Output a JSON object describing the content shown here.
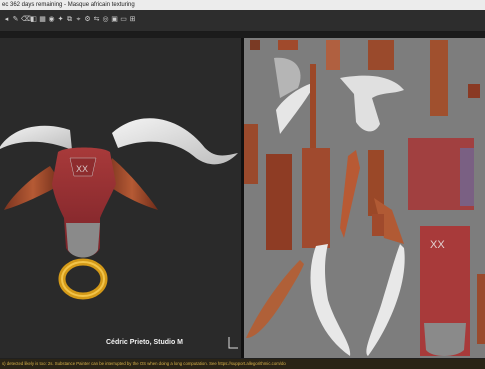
{
  "window": {
    "title": "ec 362 days remaining - Masque africain texturing"
  },
  "toolbar": {
    "icons": [
      "arrow-icon",
      "brush-icon",
      "eraser-icon",
      "projection-icon",
      "geometry-icon",
      "fill-icon",
      "smudge-icon",
      "clone-icon",
      "picker-icon",
      "settings-icon",
      "symmetry-icon",
      "camera-icon",
      "render-icon",
      "display-icon",
      "grid-icon"
    ]
  },
  "viewport3d": {
    "credit": "Cédric Prieto, Studio M"
  },
  "statusbar": {
    "text": "s) detected likely is too: 2s. Substance Painter can be interrupted by the OS when doing a long computation. See https://support.allegorithmic.com/do"
  },
  "colors": {
    "accent": "#d8b24a",
    "uv_bg": "#7d7d7d",
    "wood": "#9a4a2c",
    "horn": "#e8e8e8",
    "ring": "#d49a18"
  }
}
